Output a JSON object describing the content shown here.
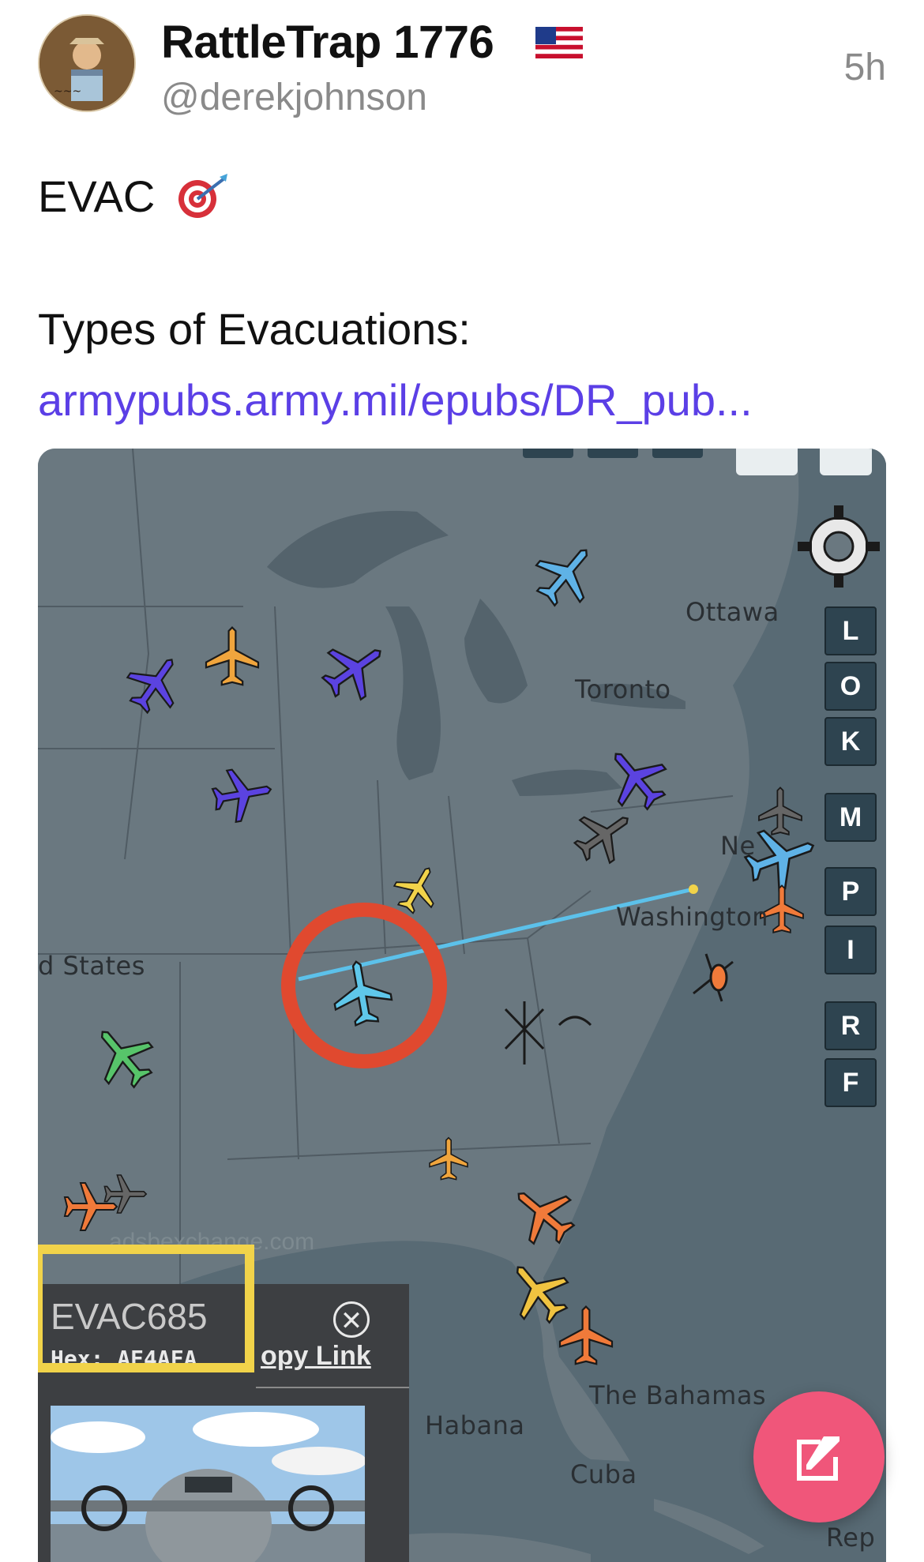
{
  "post": {
    "display_name": "RattleTrap 1776",
    "handle": "@derekjohnson",
    "time": "5h",
    "line1": "EVAC",
    "line2": "Types of Evacuations:",
    "link": "armypubs.army.mil/epubs/DR_pub..."
  },
  "map": {
    "labels": {
      "ottawa": "Ottawa",
      "toronto": "Toronto",
      "washington": "Washington",
      "new_york": "Ne",
      "united_states": "d States",
      "bahamas": "The Bahamas",
      "habana": "Habana",
      "cuba": "Cuba",
      "republic": "Rep",
      "watermark": "adsbexchange.com"
    },
    "side_buttons": [
      "L",
      "O",
      "K",
      "M",
      "P",
      "I",
      "R",
      "F"
    ],
    "info": {
      "flight_id": "EVAC685",
      "hex": "Hex: AE4AFA",
      "copy_link": "opy Link"
    }
  },
  "colors": {
    "link": "#5b3fe6",
    "highlight_circle": "#e0492f",
    "highlight_box": "#f1d34a",
    "fab": "#f0567a",
    "track": "#5cc1ea"
  }
}
